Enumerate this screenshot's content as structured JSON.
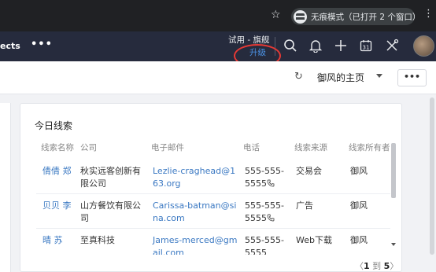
{
  "browser": {
    "incognito_label": "无痕模式（已打开 2 个窗口）",
    "star_icon": "star-icon",
    "menu_icon": "kebab-icon"
  },
  "app_header": {
    "nav_fragment": "ects",
    "nav_more": "•••",
    "trial_label": "试用 - 旗舰",
    "upgrade_label": "升级",
    "icons": [
      "search-icon",
      "bell-icon",
      "plus-icon",
      "calendar-icon",
      "tools-icon",
      "avatar"
    ]
  },
  "subbar": {
    "home_title": "御风的主页",
    "more_label": "•••"
  },
  "leads_card": {
    "title": "今日线索",
    "columns": [
      "线索名称",
      "公司",
      "电子邮件",
      "电话",
      "线索来源",
      "线索所有者"
    ],
    "rows": [
      {
        "name": "倩倩 郑",
        "company": "秋实远客创新有限公司",
        "email": "Lezlie-craghead@163.org",
        "phone": "555-555-5555",
        "source": "交易会",
        "owner": "御风"
      },
      {
        "name": "贝贝 李",
        "company": "山方餐饮有限公司",
        "email": "Carissa-batman@sina.com",
        "phone": "555-555-5555",
        "source": "广告",
        "owner": "御风"
      },
      {
        "name": "晴 苏",
        "company": "至真科技",
        "email": "James-merced@gmail.com",
        "phone": "555-555-5555",
        "source": "Web下载",
        "owner": "御风"
      }
    ],
    "pager": {
      "prev": "〈",
      "current": "1",
      "sep": "到",
      "last": "5",
      "next": "〉"
    }
  },
  "colors": {
    "header_bg": "#262b3d",
    "link": "#3a78c2",
    "annotation": "#e53935"
  }
}
